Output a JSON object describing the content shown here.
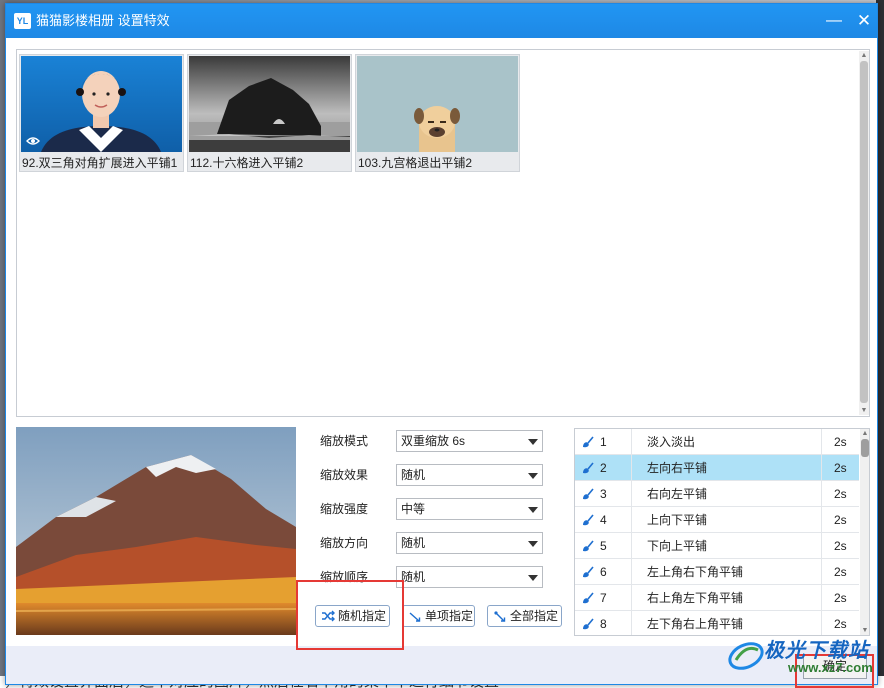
{
  "window": {
    "logo_text": "YL",
    "title": "猫猫影楼相册 设置特效",
    "minimize_glyph": "—",
    "close_glyph": "✕"
  },
  "thumbnails": [
    {
      "caption": "92.双三角对角扩展进入平铺1",
      "image": "portrait-photo",
      "has_eye_icon": true
    },
    {
      "caption": "112.十六格进入平铺2",
      "image": "rock-arch-bw-photo",
      "has_eye_icon": false
    },
    {
      "caption": "103.九宫格退出平铺2",
      "image": "cartoon-pug",
      "has_eye_icon": false
    }
  ],
  "settings": {
    "rows": [
      {
        "label": "缩放模式",
        "value": "双重缩放  6s"
      },
      {
        "label": "缩放效果",
        "value": "随机"
      },
      {
        "label": "缩放强度",
        "value": "中等"
      },
      {
        "label": "缩放方向",
        "value": "随机"
      },
      {
        "label": "缩放顺序",
        "value": "随机"
      }
    ],
    "buttons": {
      "random": "随机指定",
      "single": "单项指定",
      "all": "全部指定"
    }
  },
  "effects": [
    {
      "num": "1",
      "name": "淡入淡出",
      "duration": "2s",
      "selected": false
    },
    {
      "num": "2",
      "name": "左向右平铺",
      "duration": "2s",
      "selected": true
    },
    {
      "num": "3",
      "name": "右向左平铺",
      "duration": "2s",
      "selected": false
    },
    {
      "num": "4",
      "name": "上向下平铺",
      "duration": "2s",
      "selected": false
    },
    {
      "num": "5",
      "name": "下向上平铺",
      "duration": "2s",
      "selected": false
    },
    {
      "num": "6",
      "name": "左上角右下角平铺",
      "duration": "2s",
      "selected": false
    },
    {
      "num": "7",
      "name": "右上角左下角平铺",
      "duration": "2s",
      "selected": false
    },
    {
      "num": "8",
      "name": "左下角右上角平铺",
      "duration": "2s",
      "selected": false
    }
  ],
  "footer": {
    "ok_label": "确定"
  },
  "background_text": "，特效设置界面后，选中对应的图片，然后在右下角的菜单中进行细节设置",
  "watermark": {
    "text": "极光下载站",
    "url": "www.xz7.com"
  },
  "colors": {
    "titlebar": "#1e88e5",
    "selected_row": "#aee1f7",
    "annotation": "#e53935",
    "footer": "#eaedf8"
  }
}
